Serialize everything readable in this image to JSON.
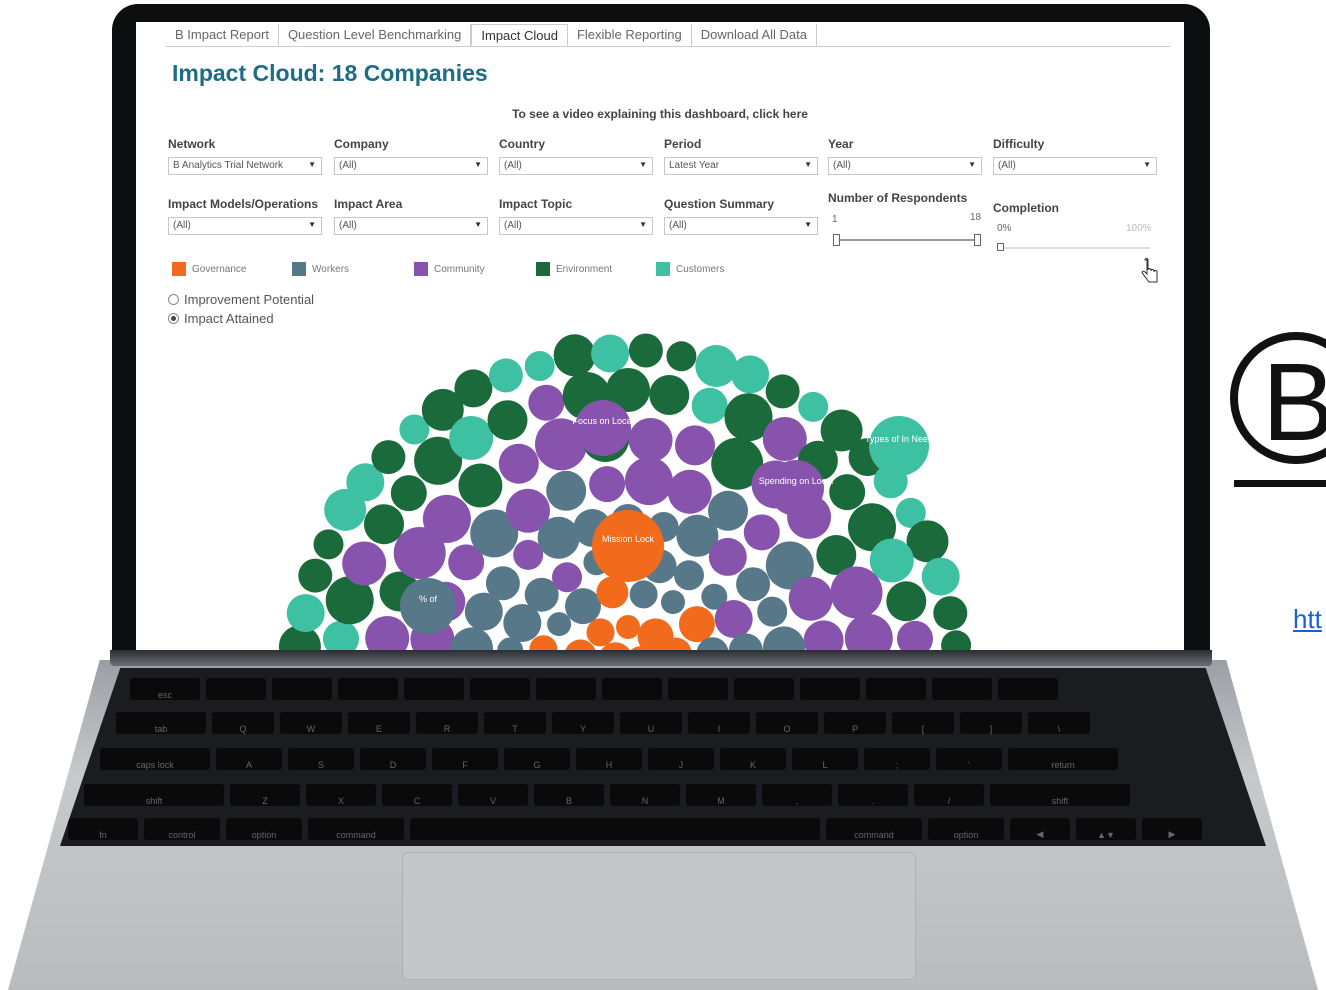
{
  "tabs": [
    "B Impact Report",
    "Question Level Benchmarking",
    "Impact Cloud",
    "Flexible Reporting",
    "Download All Data"
  ],
  "active_tab": "Impact Cloud",
  "title": "Impact Cloud: 18 Companies",
  "video_note": "To see a video explaining this dashboard, click here",
  "filters": {
    "network": {
      "label": "Network",
      "value": "B Analytics Trial Network"
    },
    "company": {
      "label": "Company",
      "value": "(All)"
    },
    "country": {
      "label": "Country",
      "value": "(All)"
    },
    "period": {
      "label": "Period",
      "value": "Latest Year"
    },
    "year": {
      "label": "Year",
      "value": "(All)"
    },
    "difficulty": {
      "label": "Difficulty",
      "value": "(All)"
    },
    "impact_models": {
      "label": "Impact Models/Operations",
      "value": "(All)"
    },
    "impact_area": {
      "label": "Impact Area",
      "value": "(All)"
    },
    "impact_topic": {
      "label": "Impact Topic",
      "value": "(All)"
    },
    "question_summary": {
      "label": "Question Summary",
      "value": "(All)"
    }
  },
  "respondents": {
    "label": "Number of Respondents",
    "min": "1",
    "max": "18"
  },
  "completion": {
    "label": "Completion",
    "min": "0%",
    "max": "100%"
  },
  "legend": [
    {
      "name": "Governance",
      "color": "#f26b1d"
    },
    {
      "name": "Workers",
      "color": "#577889"
    },
    {
      "name": "Community",
      "color": "#8753ad"
    },
    {
      "name": "Environment",
      "color": "#1b6a3b"
    },
    {
      "name": "Customers",
      "color": "#3ec1a3"
    }
  ],
  "radio": {
    "option1": "Improvement Potential",
    "option2": "Impact Attained",
    "selected": "Impact Attained"
  },
  "bubble_labels": {
    "focus": "Focus on Local",
    "spending": "Spending on Local",
    "mission": "Mission Lock",
    "types": "Types of In Need",
    "pct": "% of"
  },
  "right_url_fragment": "htt",
  "keyboard_rows": [
    [
      "esc",
      "",
      "",
      "",
      "",
      "",
      "",
      "",
      "",
      "",
      "",
      "",
      "",
      ""
    ],
    [
      "tab",
      "Q",
      "W",
      "E",
      "R",
      "T",
      "Y",
      "U",
      "I",
      "O",
      "P",
      "[",
      "]",
      "\\"
    ],
    [
      "caps lock",
      "A",
      "S",
      "D",
      "F",
      "G",
      "H",
      "J",
      "K",
      "L",
      ";",
      "'",
      "return"
    ],
    [
      "shift",
      "Z",
      "X",
      "C",
      "V",
      "B",
      "N",
      "M",
      ",",
      ".",
      "/",
      "shift"
    ],
    [
      "fn",
      "control",
      "option",
      "command",
      "",
      "command",
      "option",
      "◀",
      "▲▼",
      "▶"
    ]
  ]
}
